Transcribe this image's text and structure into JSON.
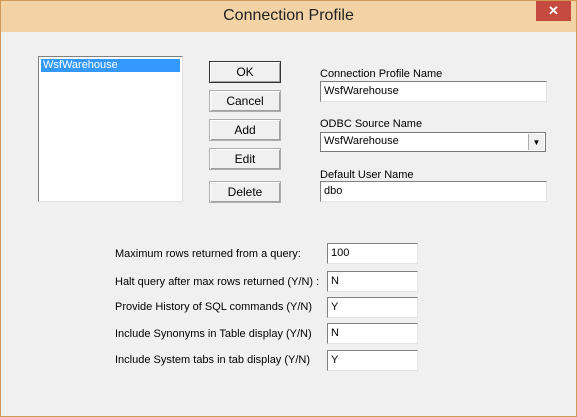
{
  "window": {
    "title": "Connection Profile",
    "close_symbol": "✕"
  },
  "profiles": {
    "items": [
      "WsfWarehouse"
    ]
  },
  "buttons": {
    "ok": "OK",
    "cancel": "Cancel",
    "add": "Add",
    "edit": "Edit",
    "delete": "Delete"
  },
  "fields": {
    "profile_name_label": "Connection Profile Name",
    "profile_name_value": "WsfWarehouse",
    "odbc_label": "ODBC Source Name",
    "odbc_value": "WsfWarehouse",
    "user_label": "Default User Name",
    "user_value": "dbo"
  },
  "options": [
    {
      "label": "Maximum rows returned from a query:",
      "value": "100"
    },
    {
      "label": "Halt query after max rows returned (Y/N) :",
      "value": "N"
    },
    {
      "label": "Provide History of SQL commands (Y/N)",
      "value": "Y"
    },
    {
      "label": "Include Synonyms in Table display (Y/N)",
      "value": "N"
    },
    {
      "label": "Include System tabs in tab display  (Y/N)",
      "value": "Y"
    }
  ],
  "colors": {
    "titlebar": "#f3d3a5",
    "selection": "#3399ff",
    "close": "#c74a40"
  }
}
